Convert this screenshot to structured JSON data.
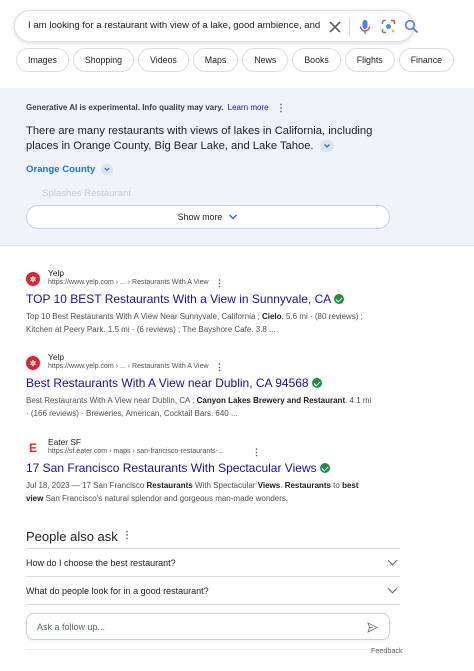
{
  "search": {
    "query": "I am looking for a restaurant with view of a lake, good ambience, and"
  },
  "chips": [
    "Images",
    "Shopping",
    "Videos",
    "Maps",
    "News",
    "Books",
    "Flights",
    "Finance"
  ],
  "ai": {
    "header": "Generative AI is experimental. Info quality may vary.",
    "learn_more": "Learn more",
    "summary": "There are many restaurants with views of lakes in California, including places in Orange County, Big Bear Lake, and Lake Tahoe.",
    "subheading": "Orange County",
    "faded_item": "Splashes Restaurant",
    "show_more": "Show more"
  },
  "results": [
    {
      "site": "Yelp",
      "url": "https://www.yelp.com › ... › Restaurants With A View",
      "title": "TOP 10 BEST Restaurants With a View in Sunnyvale, CA",
      "snippet_html": "Top 10 Best Restaurants With A View Near Sunnyvale, California ; <b>Cielo</b>. 5.6 mi · (80 reviews) ; Kitchen at Peery Park. 1.5 mi · (6 reviews) ; The Bayshore Cafe. 3.8 ..."
    },
    {
      "site": "Yelp",
      "url": "https://www.yelp.com › ... › Restaurants With A View",
      "title": "Best Restaurants With A View near Dublin, CA 94568",
      "snippet_html": "Best Restaurants With A View near Dublin, CA ; <b>Canyon Lakes Brewery and Restaurant</b>. 4.1 mi · (166 reviews) · Breweries, American, Cocktail Bars. 640 ..."
    },
    {
      "site": "Eater SF",
      "url": "https://sf.eater.com › maps › san-francisco-restaurants-...",
      "title": "17 San Francisco Restaurants With Spectacular Views",
      "snippet_html": "Jul 18, 2023 — 17 San Francisco <b>Restaurants</b> With Spectacular <b>Views</b>. <b>Restaurants</b> to <b>best view</b> San Francisco's natural splendor and gorgeous man-made wonders."
    }
  ],
  "paa": {
    "title": "People also ask",
    "questions": [
      "How do I choose the best restaurant?",
      "What do people look for in a good restaurant?"
    ]
  },
  "followup": {
    "placeholder": "Ask a follow up..."
  },
  "footer": {
    "feedback": "Feedback"
  },
  "colors": {
    "yelp": "#e0242e",
    "eater": "#e0242e",
    "link": "#1a0dab",
    "verified": "#1e8e3e"
  }
}
